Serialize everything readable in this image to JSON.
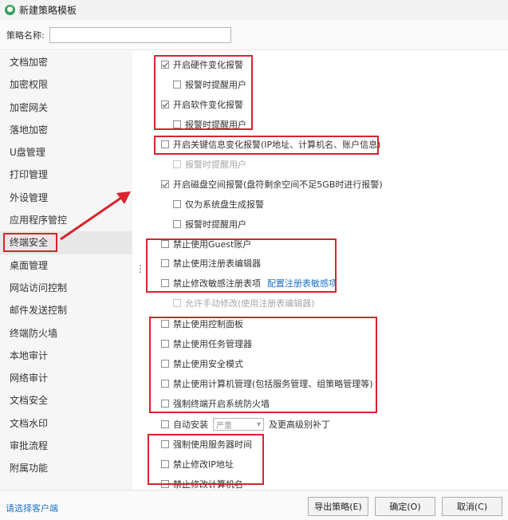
{
  "window": {
    "title": "新建策略模板",
    "icon": "app-logo-icon"
  },
  "policy_name": {
    "label": "策略名称:",
    "value": ""
  },
  "sidebar": {
    "items": [
      {
        "label": "文档加密"
      },
      {
        "label": "加密权限"
      },
      {
        "label": "加密网关"
      },
      {
        "label": "落地加密"
      },
      {
        "label": "U盘管理"
      },
      {
        "label": "打印管理"
      },
      {
        "label": "外设管理"
      },
      {
        "label": "应用程序管控"
      },
      {
        "label": "终端安全",
        "active": true
      },
      {
        "label": "桌面管理"
      },
      {
        "label": "网站访问控制"
      },
      {
        "label": "邮件发送控制"
      },
      {
        "label": "终端防火墙"
      },
      {
        "label": "本地审计"
      },
      {
        "label": "网络审计"
      },
      {
        "label": "文档安全"
      },
      {
        "label": "文档水印"
      },
      {
        "label": "审批流程"
      },
      {
        "label": "附属功能"
      }
    ]
  },
  "options": [
    {
      "label": "开启硬件变化报警",
      "checked": true,
      "disabled": false
    },
    {
      "label": "报警时提醒用户",
      "checked": false,
      "disabled": false
    },
    {
      "label": "开启软件变化报警",
      "checked": true,
      "disabled": false
    },
    {
      "label": "报警时提醒用户",
      "checked": false,
      "disabled": false
    },
    {
      "label": "开启关键信息变化报警(IP地址、计算机名、账户信息)",
      "checked": false,
      "disabled": false
    },
    {
      "label": "报警时提醒用户",
      "checked": false,
      "disabled": true
    },
    {
      "label": "开启磁盘空间报警(盘符剩余空间不足5GB时进行报警)",
      "checked": true,
      "disabled": false
    },
    {
      "label": "仅为系统盘生成报警",
      "checked": false,
      "disabled": false
    },
    {
      "label": "报警时提醒用户",
      "checked": false,
      "disabled": false
    },
    {
      "label": "禁止使用Guest账户",
      "checked": false,
      "disabled": false
    },
    {
      "label": "禁止使用注册表编辑器",
      "checked": false,
      "disabled": false
    },
    {
      "label": "禁止修改敏感注册表项",
      "checked": false,
      "disabled": false,
      "link": "配置注册表敏感项"
    },
    {
      "label": "允许手动修改(使用注册表编辑器)",
      "checked": false,
      "disabled": true
    },
    {
      "label": "禁止使用控制面板",
      "checked": false,
      "disabled": false
    },
    {
      "label": "禁止使用任务管理器",
      "checked": false,
      "disabled": false
    },
    {
      "label": "禁止使用安全模式",
      "checked": false,
      "disabled": false
    },
    {
      "label": "禁止使用计算机管理(包括服务管理、组策略管理等)",
      "checked": false,
      "disabled": false
    },
    {
      "label": "强制终端开启系统防火墙",
      "checked": false,
      "disabled": false
    },
    {
      "label": "自动安装",
      "checked": false,
      "disabled": false,
      "select_value": "严重",
      "suffix": "及更高级别补丁"
    },
    {
      "label": "强制使用服务器时间",
      "checked": false,
      "disabled": false
    },
    {
      "label": "禁止修改IP地址",
      "checked": false,
      "disabled": false
    },
    {
      "label": "禁止修改计算机名",
      "checked": false,
      "disabled": false
    }
  ],
  "footer": {
    "client_link": "请选择客户端",
    "export_button": "导出策略(E)",
    "ok_button": "确定(O)",
    "cancel_button": "取消(C)"
  },
  "colors": {
    "highlight": "#d9232e",
    "link": "#1e73c8",
    "app_icon": "#35a05a"
  }
}
